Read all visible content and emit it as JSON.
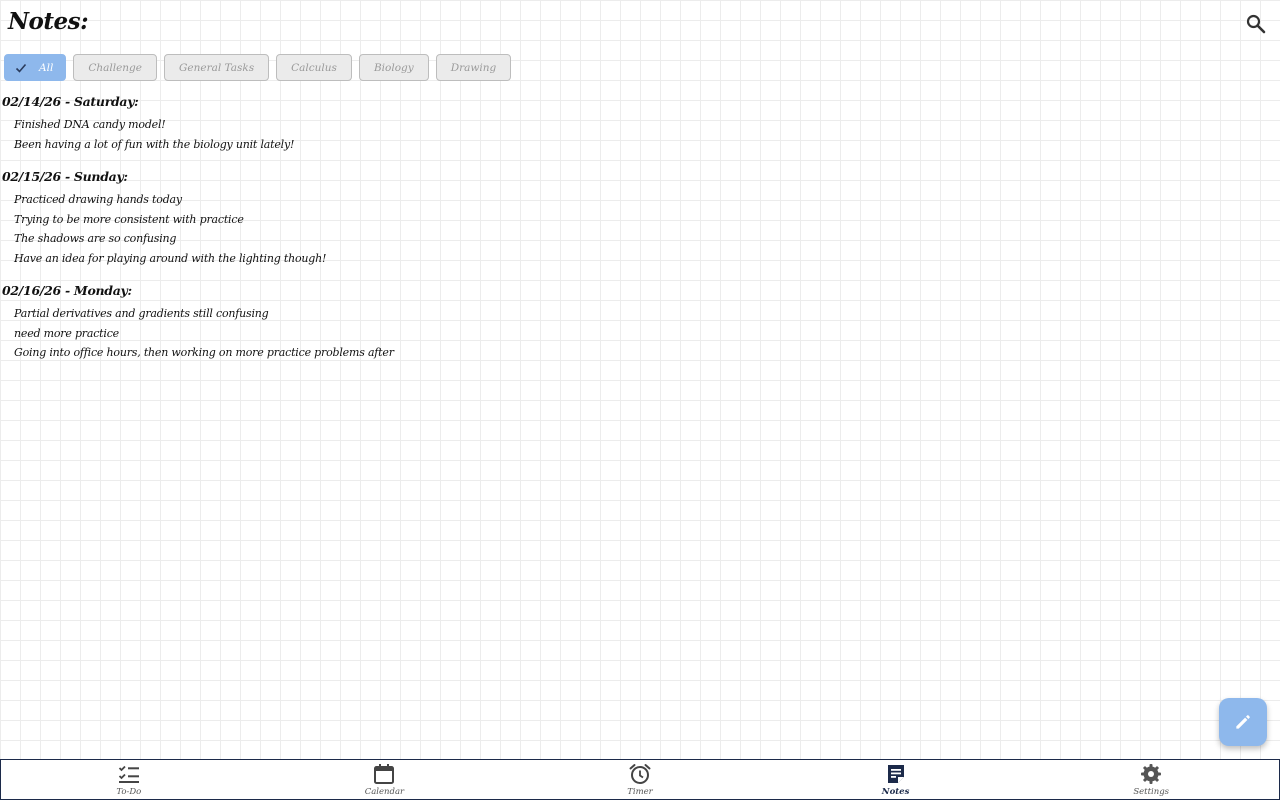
{
  "header": {
    "title": "Notes:",
    "search_icon": "search-icon"
  },
  "filters": [
    {
      "label": "All",
      "selected": true,
      "icon": "check-icon"
    },
    {
      "label": "Challenge",
      "selected": false
    },
    {
      "label": "General Tasks",
      "selected": false
    },
    {
      "label": "Calculus",
      "selected": false
    },
    {
      "label": "Biology",
      "selected": false
    },
    {
      "label": "Drawing",
      "selected": false
    }
  ],
  "notes": [
    {
      "heading": "02/14/26 - Saturday:",
      "entries": [
        "Finished DNA candy model!",
        "Been having a lot of fun with the biology unit lately!"
      ]
    },
    {
      "heading": "02/15/26 - Sunday:",
      "entries": [
        "Practiced drawing hands today",
        "Trying to be more consistent with practice",
        "The shadows are so confusing",
        "Have an idea for playing around with the lighting though!"
      ]
    },
    {
      "heading": "02/16/26 - Monday:",
      "entries": [
        "Partial derivatives and gradients still confusing",
        "need more practice",
        "Going into office hours, then working on more practice problems after"
      ]
    }
  ],
  "fab": {
    "icon": "pencil-icon"
  },
  "nav": [
    {
      "label": "To-Do",
      "icon": "checklist-icon",
      "active": false
    },
    {
      "label": "Calendar",
      "icon": "calendar-icon",
      "active": false
    },
    {
      "label": "Timer",
      "icon": "alarm-clock-icon",
      "active": false
    },
    {
      "label": "Notes",
      "icon": "note-icon",
      "active": true
    },
    {
      "label": "Settings",
      "icon": "gear-icon",
      "active": false
    }
  ],
  "colors": {
    "accent": "#8eb8ec",
    "nav_active": "#1c2a4a",
    "nav_inactive": "#555555",
    "chip_bg": "#ebebeb"
  }
}
